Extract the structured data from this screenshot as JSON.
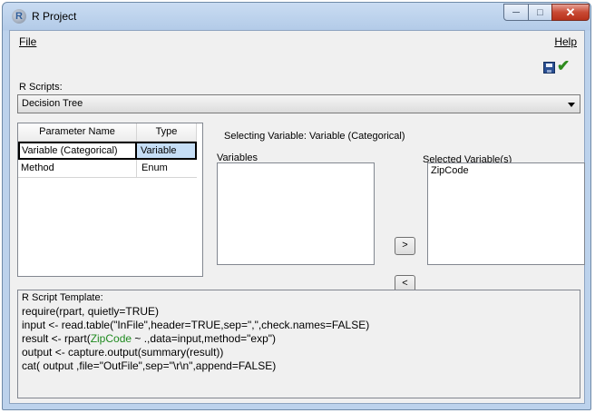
{
  "window": {
    "title": "R Project",
    "app_icon": "R"
  },
  "menu": {
    "file": "File",
    "help": "Help"
  },
  "toolbar": {
    "save_icon": "save-icon",
    "apply_icon": "checkmark-icon"
  },
  "scripts": {
    "label": "R Scripts:",
    "selected": "Decision Tree"
  },
  "params": {
    "headers": [
      "Parameter Name",
      "Type"
    ],
    "rows": [
      {
        "name": "Variable (Categorical)",
        "type": "Variable"
      },
      {
        "name": "Method",
        "type": "Enum"
      }
    ]
  },
  "variables": {
    "selecting_label": "Selecting Variable: Variable (Categorical)",
    "available_label": "Variables",
    "selected_label": "Selected Variable(s)",
    "selected_items": [
      "ZipCode"
    ],
    "add_button": ">",
    "remove_button": "<"
  },
  "template": {
    "label": "R Script Template:",
    "lines": {
      "l1": "require(rpart, quietly=TRUE)",
      "l2": "input <- read.table(\"InFile\",header=TRUE,sep=\",\",check.names=FALSE)",
      "l3a": "result <- rpart(",
      "l3b": "ZipCode",
      "l3c": " ~ .,data=input,method=\"exp\")",
      "l4": "output <- capture.output(summary(result))",
      "l5": "cat( output ,file=\"OutFile\",sep=\"\\r\\n\",append=FALSE)"
    }
  },
  "colors": {
    "selection": "#c6def6",
    "highlight_var": "#1f8a1f"
  }
}
